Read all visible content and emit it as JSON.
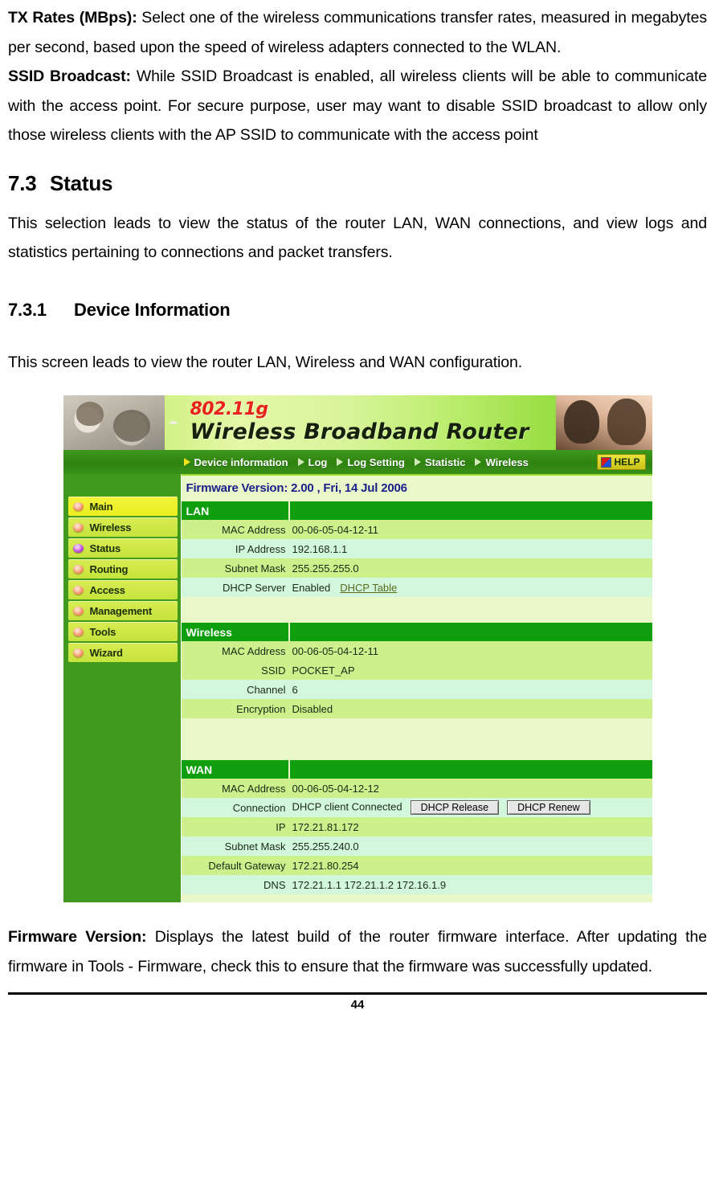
{
  "document": {
    "paragraphs": [
      {
        "id": "tx-rates",
        "label": "TX Rates (MBps):",
        "text": " Select one of the wireless communications transfer rates, measured in megabytes per second, based upon the speed of wireless adapters connected to the WLAN."
      },
      {
        "id": "ssid-broadcast",
        "label": "SSID Broadcast:",
        "text": " While SSID Broadcast is enabled, all wireless clients will be able to communicate with the access point.  For secure purpose, user may want to disable SSID broadcast to allow only those wireless clients with the AP SSID to communicate with the access point"
      }
    ],
    "section": {
      "number": "7.3",
      "title": "Status",
      "intro": "This selection leads to view the status of the router LAN, WAN connections, and view logs and statistics pertaining to connections and packet transfers."
    },
    "subsection": {
      "number": "7.3.1",
      "title": "Device Information",
      "intro": "This screen leads to view the router LAN, Wireless and WAN configuration."
    },
    "closing": {
      "label": "Firmware Version:",
      "text": " Displays the latest build of the router firmware interface. After updating the firmware in Tools - Firmware, check this to ensure that the firmware was successfully updated."
    },
    "page_number": "44"
  },
  "screenshot": {
    "banner": {
      "standard": "802.11g",
      "product": "Wireless Broadband Router"
    },
    "nav": {
      "items": [
        {
          "label": "Device information",
          "active": true
        },
        {
          "label": "Log",
          "active": false
        },
        {
          "label": "Log Setting",
          "active": false
        },
        {
          "label": "Statistic",
          "active": false
        },
        {
          "label": "Wireless",
          "active": false
        }
      ],
      "help_label": "HELP"
    },
    "sidebar": {
      "items": [
        {
          "label": "Main",
          "active": false,
          "highlight": true
        },
        {
          "label": "Wireless",
          "active": false,
          "highlight": false
        },
        {
          "label": "Status",
          "active": true,
          "highlight": false
        },
        {
          "label": "Routing",
          "active": false,
          "highlight": false
        },
        {
          "label": "Access",
          "active": false,
          "highlight": false
        },
        {
          "label": "Management",
          "active": false,
          "highlight": false
        },
        {
          "label": "Tools",
          "active": false,
          "highlight": false
        },
        {
          "label": "Wizard",
          "active": false,
          "highlight": false
        }
      ]
    },
    "firmware_version_line": "Firmware Version: 2.00 , Fri, 14 Jul 2006",
    "sections": {
      "lan": {
        "heading": "LAN",
        "rows": [
          {
            "label": "MAC Address",
            "value": "00-06-05-04-12-11"
          },
          {
            "label": "IP Address",
            "value": "192.168.1.1"
          },
          {
            "label": "Subnet Mask",
            "value": "255.255.255.0"
          },
          {
            "label": "DHCP Server",
            "value": "Enabled",
            "link": "DHCP Table"
          }
        ]
      },
      "wireless": {
        "heading": "Wireless",
        "rows": [
          {
            "label": "MAC Address",
            "value": "00-06-05-04-12-11"
          },
          {
            "label": "SSID",
            "value": "POCKET_AP"
          },
          {
            "label": "Channel",
            "value": "6"
          },
          {
            "label": "Encryption",
            "value": "Disabled"
          }
        ]
      },
      "wan": {
        "heading": "WAN",
        "rows": [
          {
            "label": "MAC Address",
            "value": "00-06-05-04-12-12"
          },
          {
            "label": "Connection",
            "value": "DHCP client Connected",
            "buttons": [
              "DHCP Release",
              "DHCP Renew"
            ]
          },
          {
            "label": "IP",
            "value": "172.21.81.172"
          },
          {
            "label": "Subnet Mask",
            "value": "255.255.240.0"
          },
          {
            "label": "Default Gateway",
            "value": "172.21.80.254"
          },
          {
            "label": "DNS",
            "value": "172.21.1.1 172.21.1.2 172.16.1.9"
          }
        ]
      }
    },
    "colors": {
      "nav_green": "#2f8210",
      "sidebar_green": "#3f9a1d",
      "section_header_green": "#0e9e0e",
      "row_alt_a": "#cdf08c",
      "row_alt_b": "#d3f7dd",
      "content_bg": "#eaf7c8",
      "firmware_text": "#1b1f8a",
      "standard_red": "#e8241a",
      "menu_yellow": "#d8ec52",
      "active_bullet_purple": "#c04fd6"
    }
  }
}
